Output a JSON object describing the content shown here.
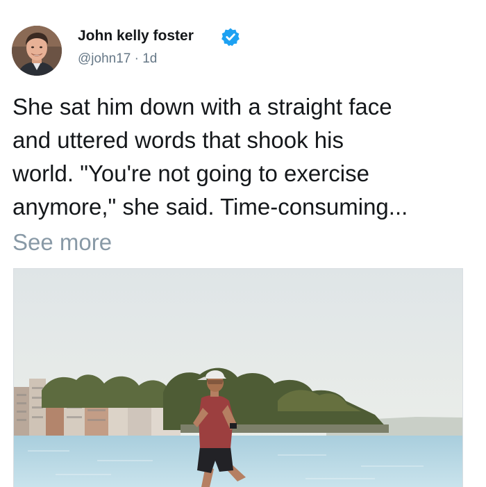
{
  "post": {
    "author": {
      "name": "John kelly foster",
      "handle": "@john17",
      "separator": "·",
      "time": "1d",
      "verified": true
    },
    "text_lines": [
      "She sat him down with a straight face",
      "and uttered words that shook his",
      "world. \"You're not going to exercise",
      "anymore,\" she said. Time-consuming..."
    ],
    "see_more_label": "See more",
    "icons": {
      "verified": "verified-badge-icon",
      "avatar": "avatar-photo"
    },
    "colors": {
      "verified_blue": "#1da1f2",
      "handle_gray": "#657786",
      "see_more_gray": "#8899a6",
      "text": "#14171a"
    }
  }
}
